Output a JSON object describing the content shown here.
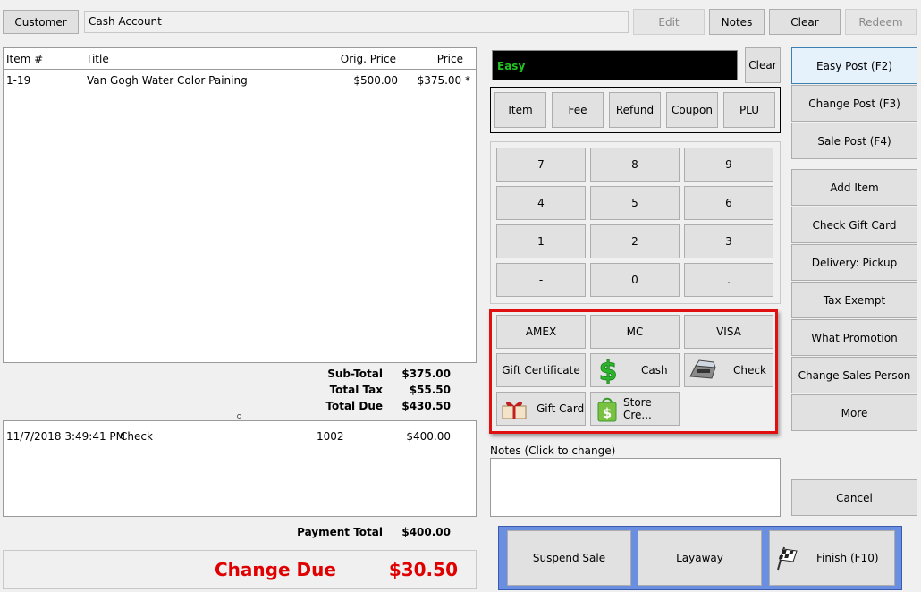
{
  "toolbar": {
    "customer_label": "Customer",
    "customer_value": "Cash Account",
    "edit_label": "Edit",
    "notes_label": "Notes",
    "clear_label": "Clear",
    "redeem_label": "Redeem"
  },
  "items_table": {
    "headers": [
      "Item #",
      "Title",
      "Orig. Price",
      "Price"
    ],
    "rows": [
      {
        "item": "1-19",
        "title": "Van Gogh Water Color Paining",
        "orig_price": "$500.00",
        "price": "$375.00 *"
      }
    ]
  },
  "totals": {
    "subtotal_label": "Sub-Total",
    "subtotal": "$375.00",
    "tax_label": "Total Tax",
    "tax": "$55.50",
    "due_label": "Total Due",
    "due": "$430.50"
  },
  "payments": {
    "rows": [
      {
        "date": "11/7/2018 3:49:41 PM",
        "method": "Check",
        "ref": "1002",
        "amount": "$400.00"
      }
    ],
    "total_label": "Payment Total",
    "total": "$400.00"
  },
  "change_due": {
    "label": "Change Due",
    "value": "$30.50",
    "color": "#e00000"
  },
  "entry": {
    "display": "Easy",
    "display_color": "#22c422",
    "clear_label": "Clear"
  },
  "entry_types": [
    "Item",
    "Fee",
    "Refund",
    "Coupon",
    "PLU"
  ],
  "keypad": [
    "7",
    "8",
    "9",
    "4",
    "5",
    "6",
    "1",
    "2",
    "3",
    "-",
    "0",
    "."
  ],
  "tenders": {
    "amex": "AMEX",
    "mc": "MC",
    "visa": "VISA",
    "gift_certificate": "Gift Certificate",
    "cash": "Cash",
    "check": "Check",
    "gift_card": "Gift Card",
    "store_credit": "Store Cre...",
    "highlight_color": "#e01010"
  },
  "notes_label": "Notes (Click to change)",
  "right_actions": {
    "easy_post": "Easy Post (F2)",
    "change_post": "Change Post (F3)",
    "sale_post": "Sale Post (F4)",
    "add_item": "Add Item",
    "check_gift_card": "Check Gift Card",
    "delivery": "Delivery: Pickup",
    "tax_exempt": "Tax Exempt",
    "what_promotion": "What Promotion",
    "change_sales_person": "Change Sales Person",
    "more": "More",
    "cancel": "Cancel"
  },
  "bottom_actions": {
    "suspend": "Suspend Sale",
    "layaway": "Layaway",
    "finish": "Finish (F10)",
    "bar_color": "#6b8fe0"
  }
}
